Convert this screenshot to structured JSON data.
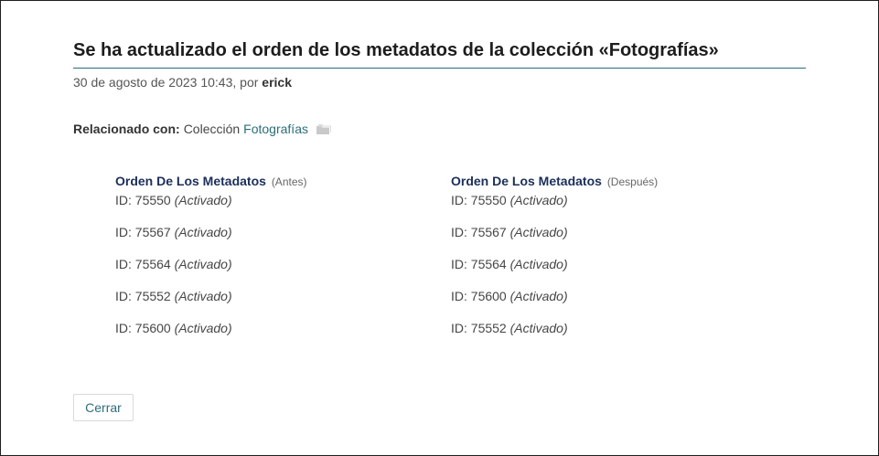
{
  "header": {
    "title": "Se ha actualizado el orden de los metadatos de la colección «Fotografías»",
    "date": "30 de agosto de 2023 10:43, por ",
    "author": "erick"
  },
  "related": {
    "label": "Relacionado con:",
    "type": "Colección",
    "link": "Fotografías",
    "icon": "folder-icon"
  },
  "before": {
    "title": "Orden De Los Metadatos",
    "qualifier": "(Antes)",
    "items": [
      {
        "id": "ID: 75550",
        "status": "(Activado)"
      },
      {
        "id": "ID: 75567",
        "status": "(Activado)"
      },
      {
        "id": "ID: 75564",
        "status": "(Activado)"
      },
      {
        "id": "ID: 75552",
        "status": "(Activado)"
      },
      {
        "id": "ID: 75600",
        "status": "(Activado)"
      }
    ]
  },
  "after": {
    "title": "Orden De Los Metadatos",
    "qualifier": "(Después)",
    "items": [
      {
        "id": "ID: 75550",
        "status": "(Activado)"
      },
      {
        "id": "ID: 75567",
        "status": "(Activado)"
      },
      {
        "id": "ID: 75564",
        "status": "(Activado)"
      },
      {
        "id": "ID: 75600",
        "status": "(Activado)"
      },
      {
        "id": "ID: 75552",
        "status": "(Activado)"
      }
    ]
  },
  "footer": {
    "close_label": "Cerrar"
  },
  "colors": {
    "accent": "#2c6e79",
    "heading": "#1b2f5a"
  }
}
